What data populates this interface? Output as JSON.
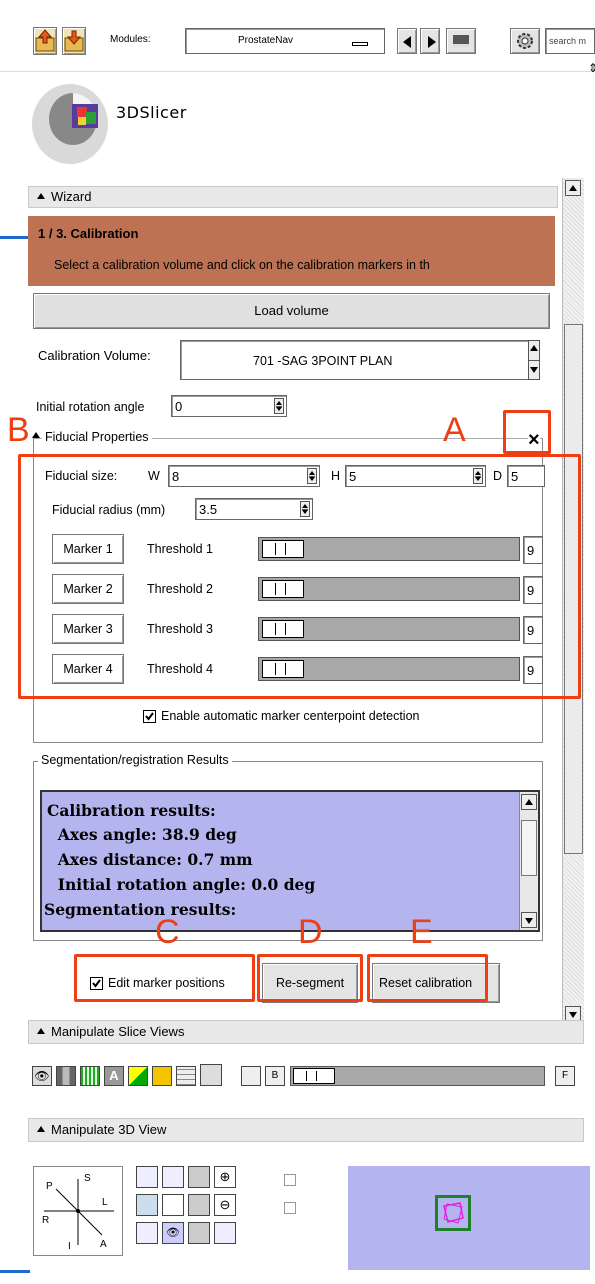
{
  "toolbar": {
    "modules_label": "Modules:",
    "module_selected": "ProstateNav",
    "search_placeholder": "search m"
  },
  "logo": {
    "text_pre": "3D",
    "text_main": "Slicer"
  },
  "wizard": {
    "header": "Wizard",
    "step_title": "1 / 3. Calibration",
    "step_desc": "Select a calibration volume and click on the calibration markers in th",
    "load_volume": "Load volume",
    "calib_volume_label": "Calibration Volume:",
    "calib_volume_value": "701 -SAG 3POINT PLAN",
    "init_rot_label": "Initial rotation angle",
    "init_rot_value": "0"
  },
  "fiducial": {
    "header": "Fiducial Properties",
    "close": "×",
    "size_label": "Fiducial size:",
    "w_label": "W",
    "w_value": "8",
    "h_label": "H",
    "h_value": "5",
    "d_label": "D",
    "d_value": "5",
    "radius_label": "Fiducial radius (mm)",
    "radius_value": "3.5",
    "markers": [
      {
        "label": "Marker 1",
        "threshold": "Threshold 1",
        "value": "9"
      },
      {
        "label": "Marker 2",
        "threshold": "Threshold 2",
        "value": "9"
      },
      {
        "label": "Marker 3",
        "threshold": "Threshold 3",
        "value": "9"
      },
      {
        "label": "Marker 4",
        "threshold": "Threshold 4",
        "value": "9"
      }
    ],
    "auto_detect": "Enable automatic marker centerpoint detection"
  },
  "results": {
    "header": "Segmentation/registration Results",
    "lines": [
      "Calibration results:",
      "  Axes angle: 38.9 deg",
      "  Axes distance: 0.7 mm",
      "  Initial rotation angle: 0.0 deg",
      "Segmentation results:"
    ]
  },
  "actions": {
    "edit_markers": "Edit marker positions",
    "resegment": "Re-segment",
    "reset_calibration": "Reset calibration"
  },
  "annotations": {
    "a": "A",
    "b": "B",
    "c": "C",
    "d": "D",
    "e": "E"
  },
  "slice_views": {
    "header": "Manipulate Slice Views"
  },
  "view3d": {
    "header": "Manipulate 3D View",
    "axis_s": "S",
    "axis_p": "P",
    "axis_l": "L",
    "axis_r": "R",
    "axis_i": "I",
    "axis_a": "A"
  },
  "colors": {
    "step_bg": "#bd7253",
    "results_bg": "#b4b4ee",
    "annotation": "#ef3e12",
    "preview_bg": "#b4b4ee"
  }
}
